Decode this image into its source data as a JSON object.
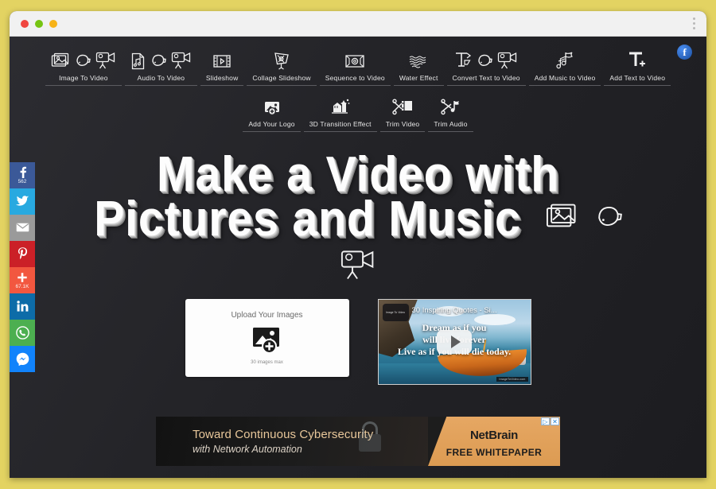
{
  "window": {
    "lights": [
      "close",
      "minimize",
      "maximize"
    ],
    "menu_icon": "kebab-menu-icon"
  },
  "nav": {
    "row1": [
      {
        "label": "Image To Video",
        "icons": [
          "image-icon",
          "hand-pointer-icon",
          "video-camera-icon"
        ]
      },
      {
        "label": "Audio To Video",
        "icons": [
          "audio-file-icon",
          "hand-pointer-icon",
          "video-camera-icon"
        ]
      },
      {
        "label": "Slideshow",
        "icons": [
          "filmstrip-icon"
        ]
      },
      {
        "label": "Collage Slideshow",
        "icons": [
          "collage-icon"
        ]
      },
      {
        "label": "Sequence to Video",
        "icons": [
          "sequence-icon"
        ]
      },
      {
        "label": "Water Effect",
        "icons": [
          "water-waves-icon"
        ]
      },
      {
        "label": "Convert Text to Video",
        "icons": [
          "text-icon",
          "hand-pointer-icon",
          "video-camera-icon"
        ]
      },
      {
        "label": "Add Music to Video",
        "icons": [
          "music-note-icon"
        ]
      },
      {
        "label": "Add Text to Video",
        "icons": [
          "text-plus-icon"
        ]
      }
    ],
    "row2": [
      {
        "label": "Add Your Logo",
        "icons": [
          "add-logo-icon"
        ]
      },
      {
        "label": "3D Transition Effect",
        "icons": [
          "transition-icon"
        ]
      },
      {
        "label": "Trim Video",
        "icons": [
          "scissors-video-icon"
        ]
      },
      {
        "label": "Trim Audio",
        "icons": [
          "scissors-audio-icon"
        ]
      }
    ],
    "facebook_badge": "f"
  },
  "hero": {
    "line1": "Make a Video with",
    "line2": "Pictures and Music",
    "inline_icons": [
      "image-icon",
      "hand-pointer-icon"
    ],
    "below_icon": "video-camera-icon"
  },
  "upload": {
    "title": "Upload Your Images",
    "note": "30 images max",
    "icon": "add-image-icon"
  },
  "video": {
    "title": "30 Inspiring Quotes - Si...",
    "channel": "Image To Video",
    "quote_line1": "Dream as if you",
    "quote_line2": "will live forever",
    "quote_line3": "Live as if you will die today.",
    "watermark": "ImageToVideo.com",
    "play_button": "play-icon"
  },
  "social": [
    {
      "name": "facebook",
      "glyph": "facebook-icon",
      "count": "562",
      "color": "#3b5998"
    },
    {
      "name": "twitter",
      "glyph": "twitter-icon",
      "count": "",
      "color": "#28a9e0"
    },
    {
      "name": "email",
      "glyph": "envelope-icon",
      "count": "",
      "color": "#9a9a9a"
    },
    {
      "name": "pinterest",
      "glyph": "pinterest-icon",
      "count": "",
      "color": "#cb2027"
    },
    {
      "name": "share-more",
      "glyph": "plus-icon",
      "count": "67.1K",
      "color": "#f2573f"
    },
    {
      "name": "linkedin",
      "glyph": "linkedin-icon",
      "count": "",
      "color": "#0d6ca8"
    },
    {
      "name": "whatsapp",
      "glyph": "whatsapp-icon",
      "count": "",
      "color": "#4caf50"
    },
    {
      "name": "messenger",
      "glyph": "messenger-icon",
      "count": "",
      "color": "#1183fb"
    }
  ],
  "ad": {
    "headline": "Toward Continuous Cybersecurity",
    "subhead": "with Network Automation",
    "brand": "NetBrain",
    "cta": "FREE WHITEPAPER",
    "adchoices": "▷",
    "close": "✕",
    "lock_icon": "padlock-icon"
  },
  "colors": {
    "frame": "#e3d362",
    "page_bg": "#232327",
    "accent_orange": "#e6a763"
  }
}
